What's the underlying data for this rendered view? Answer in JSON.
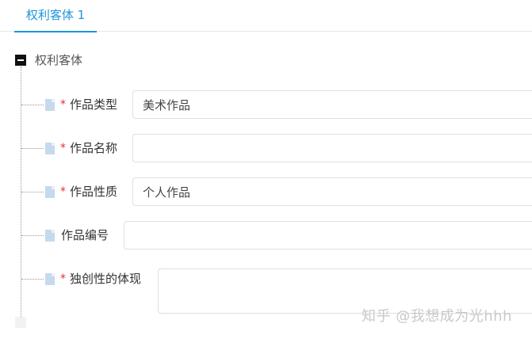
{
  "tab": {
    "label": "权利客体 1",
    "active": true,
    "accent": "#1e94dc"
  },
  "tree": {
    "root_label": "权利客体",
    "toggle_icon": "minus-square-icon",
    "leaf_icon": "document-icon",
    "required_marker": "*",
    "fields": [
      {
        "label": "作品类型",
        "required": true,
        "value": "美术作品"
      },
      {
        "label": "作品名称",
        "required": true,
        "value": ""
      },
      {
        "label": "作品性质",
        "required": true,
        "value": "个人作品"
      },
      {
        "label": "作品编号",
        "required": false,
        "value": ""
      },
      {
        "label": "独创性的体现",
        "required": true,
        "value": ""
      }
    ]
  },
  "watermark": "知乎 @我想成为光hhh",
  "colors": {
    "required": "#e0302c",
    "border": "#dcdfe6",
    "leaf": "#c7d9ec"
  }
}
